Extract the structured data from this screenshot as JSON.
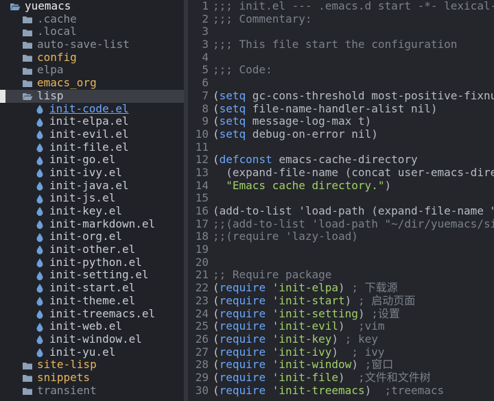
{
  "tree": {
    "items": [
      {
        "name": "yuemacs",
        "type": "root",
        "depth": 0,
        "icon": "folder-open-icon",
        "color": "#f0f0f0"
      },
      {
        "name": ".cache",
        "type": "dir-dim",
        "depth": 1,
        "icon": "folder-icon"
      },
      {
        "name": ".local",
        "type": "dir-dim",
        "depth": 1,
        "icon": "folder-icon"
      },
      {
        "name": "auto-save-list",
        "type": "dir-dim",
        "depth": 1,
        "icon": "folder-icon"
      },
      {
        "name": "config",
        "type": "dir",
        "depth": 1,
        "icon": "folder-icon"
      },
      {
        "name": "elpa",
        "type": "dir-dim",
        "depth": 1,
        "icon": "folder-icon"
      },
      {
        "name": "emacs_org",
        "type": "dir",
        "depth": 1,
        "icon": "folder-icon"
      },
      {
        "name": "lisp",
        "type": "dir-open",
        "depth": 1,
        "icon": "folder-open-icon",
        "selected": true
      },
      {
        "name": "init-code.el",
        "type": "file",
        "depth": 2,
        "icon": "drop-icon",
        "active": true
      },
      {
        "name": "init-elpa.el",
        "type": "file",
        "depth": 2,
        "icon": "drop-icon"
      },
      {
        "name": "init-evil.el",
        "type": "file",
        "depth": 2,
        "icon": "drop-icon"
      },
      {
        "name": "init-file.el",
        "type": "file",
        "depth": 2,
        "icon": "drop-icon"
      },
      {
        "name": "init-go.el",
        "type": "file",
        "depth": 2,
        "icon": "drop-icon"
      },
      {
        "name": "init-ivy.el",
        "type": "file",
        "depth": 2,
        "icon": "drop-icon"
      },
      {
        "name": "init-java.el",
        "type": "file",
        "depth": 2,
        "icon": "drop-icon"
      },
      {
        "name": "init-js.el",
        "type": "file",
        "depth": 2,
        "icon": "drop-icon"
      },
      {
        "name": "init-key.el",
        "type": "file",
        "depth": 2,
        "icon": "drop-icon"
      },
      {
        "name": "init-markdown.el",
        "type": "file",
        "depth": 2,
        "icon": "drop-icon"
      },
      {
        "name": "init-org.el",
        "type": "file",
        "depth": 2,
        "icon": "drop-icon"
      },
      {
        "name": "init-other.el",
        "type": "file",
        "depth": 2,
        "icon": "drop-icon"
      },
      {
        "name": "init-python.el",
        "type": "file",
        "depth": 2,
        "icon": "drop-icon"
      },
      {
        "name": "init-setting.el",
        "type": "file",
        "depth": 2,
        "icon": "drop-icon"
      },
      {
        "name": "init-start.el",
        "type": "file",
        "depth": 2,
        "icon": "drop-icon"
      },
      {
        "name": "init-theme.el",
        "type": "file",
        "depth": 2,
        "icon": "drop-icon"
      },
      {
        "name": "init-treemacs.el",
        "type": "file",
        "depth": 2,
        "icon": "drop-icon"
      },
      {
        "name": "init-web.el",
        "type": "file",
        "depth": 2,
        "icon": "drop-icon"
      },
      {
        "name": "init-window.el",
        "type": "file",
        "depth": 2,
        "icon": "drop-icon"
      },
      {
        "name": "init-yu.el",
        "type": "file",
        "depth": 2,
        "icon": "drop-icon"
      },
      {
        "name": "site-lisp",
        "type": "dir",
        "depth": 1,
        "icon": "folder-icon"
      },
      {
        "name": "snippets",
        "type": "dir",
        "depth": 1,
        "icon": "folder-icon"
      },
      {
        "name": "transient",
        "type": "dir-dim",
        "depth": 1,
        "icon": "folder-icon"
      }
    ]
  },
  "editor": {
    "lines": [
      {
        "n": "1",
        "tokens": [
          [
            "cmt",
            ";;; init.el --- .emacs.d start -*- lexical-binding: t -*-"
          ]
        ]
      },
      {
        "n": "2",
        "tokens": [
          [
            "cmt",
            ";;; Commentary:"
          ]
        ]
      },
      {
        "n": "3",
        "tokens": []
      },
      {
        "n": "3",
        "tokens": [
          [
            "cmt",
            ";;; This file start the configuration"
          ]
        ]
      },
      {
        "n": "4",
        "tokens": []
      },
      {
        "n": "5",
        "tokens": [
          [
            "cmt",
            ";;; Code:"
          ]
        ]
      },
      {
        "n": "6",
        "tokens": []
      },
      {
        "n": "7",
        "tokens": [
          [
            "paren",
            "("
          ],
          [
            "kw",
            "setq"
          ],
          [
            "plain",
            " gc-cons-threshold most-positive-fixnum)"
          ]
        ]
      },
      {
        "n": "8",
        "tokens": [
          [
            "paren",
            "("
          ],
          [
            "kw",
            "setq"
          ],
          [
            "plain",
            " file-name-handler-alist nil)"
          ]
        ]
      },
      {
        "n": "9",
        "tokens": [
          [
            "paren",
            "("
          ],
          [
            "kw",
            "setq"
          ],
          [
            "plain",
            " message-log-max t)"
          ]
        ]
      },
      {
        "n": "10",
        "tokens": [
          [
            "paren",
            "("
          ],
          [
            "kw",
            "setq"
          ],
          [
            "plain",
            " debug-on-error nil)"
          ]
        ]
      },
      {
        "n": "11",
        "tokens": []
      },
      {
        "n": "12",
        "tokens": [
          [
            "paren",
            "("
          ],
          [
            "kw",
            "defconst"
          ],
          [
            "plain",
            " emacs-cache-directory"
          ]
        ]
      },
      {
        "n": "13",
        "tokens": [
          [
            "plain",
            "  (expand-file-name (concat user-emacs-directory \".cache/\"))"
          ]
        ]
      },
      {
        "n": "14",
        "tokens": [
          [
            "plain",
            "  "
          ],
          [
            "str",
            "\"Emacs cache directory.\""
          ],
          [
            "plain",
            ")"
          ]
        ]
      },
      {
        "n": "15",
        "tokens": []
      },
      {
        "n": "16",
        "tokens": [
          [
            "plain",
            "(add-to-list 'load-path (expand-file-name \"lisp\" user-emacs-directory))"
          ]
        ]
      },
      {
        "n": "17",
        "tokens": [
          [
            "cmt",
            ";;(add-to-list 'load-path \"~/dir/yuemacs/site-lisp\")"
          ]
        ]
      },
      {
        "n": "18",
        "tokens": [
          [
            "cmt",
            ";;(require 'lazy-load)"
          ]
        ]
      },
      {
        "n": "19",
        "tokens": []
      },
      {
        "n": "20",
        "tokens": []
      },
      {
        "n": "21",
        "tokens": [
          [
            "cmt",
            ";; Require package"
          ]
        ]
      },
      {
        "n": "22",
        "tokens": [
          [
            "paren",
            "("
          ],
          [
            "kw",
            "require"
          ],
          [
            "plain",
            " '"
          ],
          [
            "str",
            "init-elpa"
          ],
          [
            "plain",
            ") "
          ],
          [
            "cmt",
            "; 下载源"
          ]
        ]
      },
      {
        "n": "23",
        "tokens": [
          [
            "paren",
            "("
          ],
          [
            "kw",
            "require"
          ],
          [
            "plain",
            " '"
          ],
          [
            "str",
            "init-start"
          ],
          [
            "plain",
            ") "
          ],
          [
            "cmt",
            "; 启动页面"
          ]
        ]
      },
      {
        "n": "24",
        "tokens": [
          [
            "paren",
            "("
          ],
          [
            "kw",
            "require"
          ],
          [
            "plain",
            " '"
          ],
          [
            "str",
            "init-setting"
          ],
          [
            "plain",
            ") "
          ],
          [
            "cmt",
            ";设置"
          ]
        ]
      },
      {
        "n": "25",
        "tokens": [
          [
            "paren",
            "("
          ],
          [
            "kw",
            "require"
          ],
          [
            "plain",
            " '"
          ],
          [
            "str",
            "init-evil"
          ],
          [
            "plain",
            ")  "
          ],
          [
            "cmt",
            ";vim"
          ]
        ]
      },
      {
        "n": "26",
        "tokens": [
          [
            "paren",
            "("
          ],
          [
            "kw",
            "require"
          ],
          [
            "plain",
            " '"
          ],
          [
            "str",
            "init-key"
          ],
          [
            "plain",
            ") "
          ],
          [
            "cmt",
            "; key"
          ]
        ]
      },
      {
        "n": "27",
        "tokens": [
          [
            "paren",
            "("
          ],
          [
            "kw",
            "require"
          ],
          [
            "plain",
            " '"
          ],
          [
            "str",
            "init-ivy"
          ],
          [
            "plain",
            ")  "
          ],
          [
            "cmt",
            "; ivy"
          ]
        ]
      },
      {
        "n": "28",
        "tokens": [
          [
            "paren",
            "("
          ],
          [
            "kw",
            "require"
          ],
          [
            "plain",
            " '"
          ],
          [
            "str",
            "init-window"
          ],
          [
            "plain",
            ") "
          ],
          [
            "cmt",
            ";窗口"
          ]
        ]
      },
      {
        "n": "29",
        "tokens": [
          [
            "paren",
            "("
          ],
          [
            "kw",
            "require"
          ],
          [
            "plain",
            " '"
          ],
          [
            "str",
            "init-file"
          ],
          [
            "plain",
            ")  "
          ],
          [
            "cmt",
            ";文件和文件树"
          ]
        ]
      },
      {
        "n": "30",
        "tokens": [
          [
            "paren",
            "("
          ],
          [
            "kw",
            "require"
          ],
          [
            "plain",
            " '"
          ],
          [
            "str",
            "init-treemacs"
          ],
          [
            "plain",
            ")  "
          ],
          [
            "cmt",
            ";treemacs"
          ]
        ]
      }
    ]
  },
  "colors": {
    "keyword": "#6aa8ff",
    "string": "#a3d266",
    "comment": "#7c818a",
    "directory": "#e8b75a",
    "icon": "#6e9fd8"
  }
}
